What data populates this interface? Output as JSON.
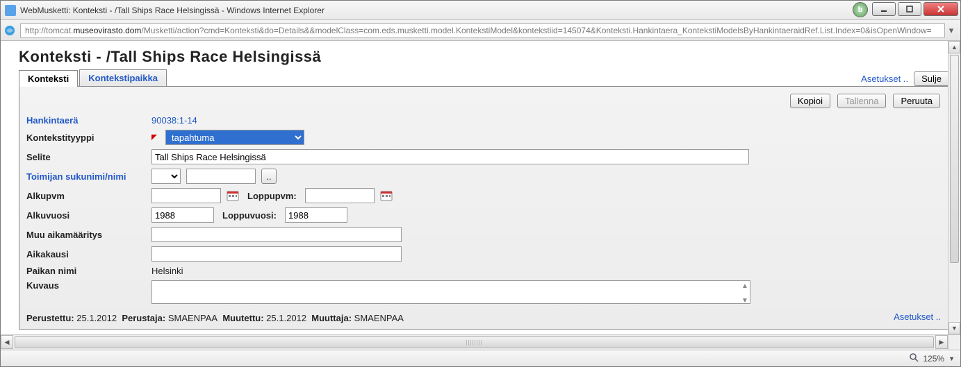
{
  "window": {
    "title": "WebMusketti: Konteksti - /Tall Ships Race Helsingissä - Windows Internet Explorer",
    "url_prefix": "http://tomcat.",
    "url_host": "museovirasto.dom",
    "url_rest": "/Musketti/action?cmd=Konteksti&do=Details&&modelClass=com.eds.musketti.model.KontekstiModel&kontekstiid=145074&Konteksti.Hankintaera_KontekstiModelsByHankintaeraidRef.List.Index=0&isOpenWindow="
  },
  "page": {
    "title": "Konteksti  - /Tall Ships Race Helsingissä"
  },
  "tabs": {
    "konteksti": "Konteksti",
    "kontekstipaikka": "Kontekstipaikka"
  },
  "topRight": {
    "asetukset": "Asetukset ..",
    "sulje": "Sulje"
  },
  "toolbar": {
    "kopioi": "Kopioi",
    "tallenna": "Tallenna",
    "peruuta": "Peruuta"
  },
  "labels": {
    "hankintaera": "Hankintaerä",
    "kontekstityyppi": "Kontekstityyppi",
    "selite": "Selite",
    "toimija": "Toimijan sukunimi/nimi",
    "alkupvm": "Alkupvm",
    "loppupvm": "Loppupvm:",
    "alkuvuosi": "Alkuvuosi",
    "loppuvuosi": "Loppuvuosi:",
    "muu": "Muu aikamääritys",
    "aikakausi": "Aikakausi",
    "paikka": "Paikan nimi",
    "kuvaus": "Kuvaus"
  },
  "values": {
    "hankintaera": "90038:1-14",
    "kontekstityyppi": "tapahtuma",
    "selite": "Tall Ships Race Helsingissä",
    "toimija_prefix": "",
    "toimija_name": "",
    "alkupvm": "",
    "loppupvm": "",
    "alkuvuosi": "1988",
    "loppuvuosi": "1988",
    "muu": "",
    "aikakausi": "",
    "paikka": "Helsinki",
    "kuvaus": ""
  },
  "audit": {
    "perustettu_lbl": "Perustettu:",
    "perustettu": "25.1.2012",
    "perustaja_lbl": "Perustaja:",
    "perustaja": "SMAENPAA",
    "muutettu_lbl": "Muutettu:",
    "muutettu": "25.1.2012",
    "muuttaja_lbl": "Muuttaja:",
    "muuttaja": "SMAENPAA"
  },
  "bottom": {
    "asetukset": "Asetukset .."
  },
  "status": {
    "zoom": "125%"
  }
}
